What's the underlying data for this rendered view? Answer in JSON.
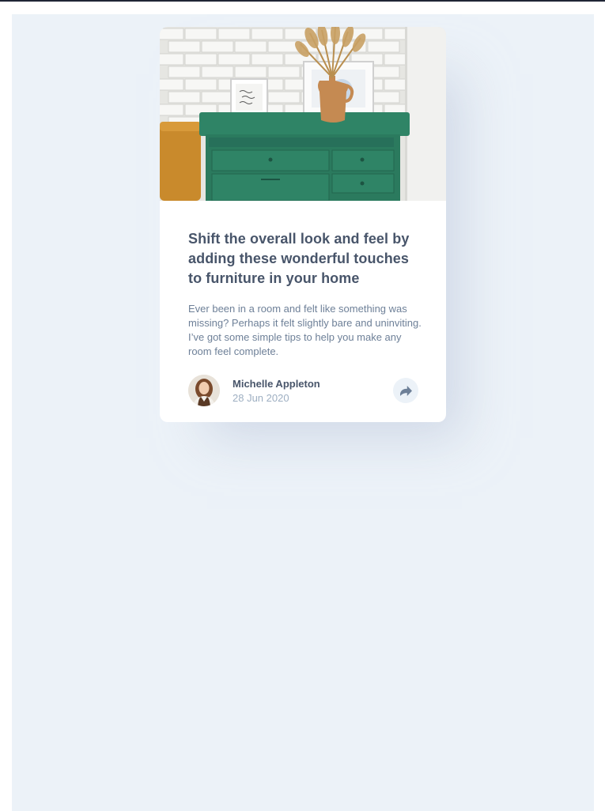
{
  "article": {
    "title": "Shift the overall look and feel by adding these wonderful touches to furniture in your home",
    "excerpt": "Ever been in a room and felt like something was missing? Perhaps it felt slightly bare and uninviting. I’ve got some simple tips to help you make any room feel complete."
  },
  "author": {
    "name": "Michelle Appleton",
    "date": "28 Jun 2020"
  },
  "icons": {
    "share": "share-icon"
  },
  "colors": {
    "background": "#ecf2f8",
    "title": "#48556a",
    "body_text": "#6e8098",
    "muted": "#9eafc2",
    "dresser_green": "#2c7a60"
  }
}
